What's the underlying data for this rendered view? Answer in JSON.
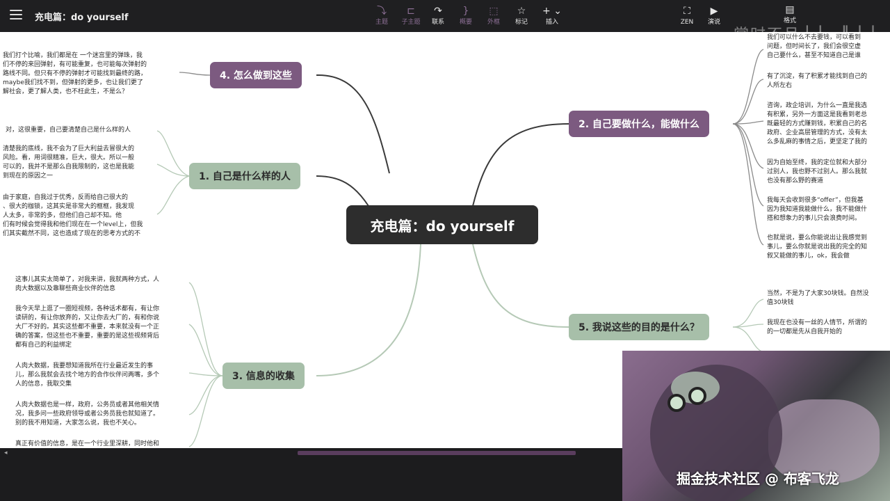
{
  "window": {
    "title": "充电篇：do yourself"
  },
  "toolbar": {
    "items": [
      {
        "label": "主题",
        "icon": "⤵"
      },
      {
        "label": "子主题",
        "icon": "⊏"
      },
      {
        "label": "联系",
        "icon": "↷"
      },
      {
        "label": "概要",
        "icon": "}"
      },
      {
        "label": "外框",
        "icon": "⬚"
      },
      {
        "label": "标记",
        "icon": "☆"
      },
      {
        "label": "插入",
        "icon": "+ ⌄"
      }
    ],
    "right_items": [
      {
        "label": "ZEN",
        "icon": "⛶"
      },
      {
        "label": "演说",
        "icon": "▶"
      },
      {
        "label": "格式",
        "icon": "▤"
      }
    ]
  },
  "bg_title": "掌时不月  ▏▏▕▏▏▏",
  "map": {
    "center": "充电篇：do yourself",
    "nodes": {
      "n4": "4. 怎么做到这些",
      "n1": "1. 自己是什么样的人",
      "n3": "3. 信息的收集",
      "n2": "2. 自己要做什么，能做什么",
      "n5": "5. 我说这些的目的是什么？"
    },
    "texts": {
      "t4": "我们打个比喻，我们都是在 一个迷宫里的弹珠，我\n们不停的来回弹射，有可能重复，也可能每次弹射的\n路线不同。但只有不停的弹射才可能找到最终的路，\nmaybe我们找不到，但弹射的更多，也让我们更了\n解社会，更了解人类，也不枉此生，不是么？",
      "t1a": "对，这很重要，自己要清楚自己是什么样的人",
      "t1b": "清楚我的底线，我不会为了巨大利益去冒很大的\n风险。看，用词很精准，巨大，很大。所以一般\n可以的，我并不是那么自我限制的，这也是我能\n到现在的原因之一",
      "t1c": "由于家庭，自我过于优秀，反而给自己很大的\n、很大的枷锁，这其实是非常大的框框，我发现\n人太多，非常的多，但他们自己却不知。他\n们有时候会觉得我和他们现在在一个level上，但我\n们其实截然不同，这也造成了现在的思考方式的不",
      "t3a": "这事儿其实太简单了，对我来讲，我就两种方式，人\n肉大数据以及靠聊些商业伙伴的信息",
      "t3b": "我今天早上逛了一圈短视频，各种话术都有，有让你\n读研的，有让你放弃的，又让你去大厂的，有和你说\n大厂不好的。其实这些都不重要，本来就没有一个正\n确的答案，但这些也不重要，重要的是这些视频背后\n都有自己的利益绑定",
      "t3c": "人肉大数据，我要想知道我所在行业最近发生的事\n儿，那么我就会去找个地方的合作伙伴问两嘴，多个\n人的信息，我取交集",
      "t3d": "人肉大数据也是一样，政府，公务员或者其他相关情\n况，我多问一些政府领导或者公务员我也就知道了。\n别的我不用知道，大家怎么说，我也不关心。",
      "t3e": "真正有价值的信息，是在一个行业里深耕，同时他和",
      "t2a": "我们可以什么不去要钱，可以看到\n问题，但时间长了，我们会很空虚\n自己要什么，甚至不知道自己是谁",
      "t2b": "有了沉淀，有了积累才能找到自己的\n人所左右",
      "t2c": "咨询，政企培训，为什么一直是我选\n有积累，另外一方面这是我看到老总\n既最轻的方式赚到钱，积累自己的名\n政府、企业高层管理的方式，没有太\n么多乱麻的事情之后，更坚定了我的",
      "t2d": "因为自始至终，我的定位就和大部分\n过别人，我也野不过别人。那么我就\n也没有那么野的赛道",
      "t2e": "我每天会收到很多“offer”，但我基\n因为我知道我能做什么，我不能做什\n搭和想象力的事儿只会浪费时间。",
      "t2f": "也就是说，要么你能说出让我感觉到\n事儿，要么你就是说出我的完全的知\n叙又能做的事儿，ok，我会做",
      "t5a": "当然，不是为了大家30块钱。自然没\n值30块钱",
      "t5b": "我现在也没有一丝的人情节，所谓的\n的一切都是先从自我开始的"
    }
  },
  "video": {
    "watermark": "掘金技术社区 @ 布客飞龙"
  },
  "colors": {
    "purple": "#7c5a80",
    "green": "#a7bfa9",
    "center": "#2d2d2d"
  }
}
